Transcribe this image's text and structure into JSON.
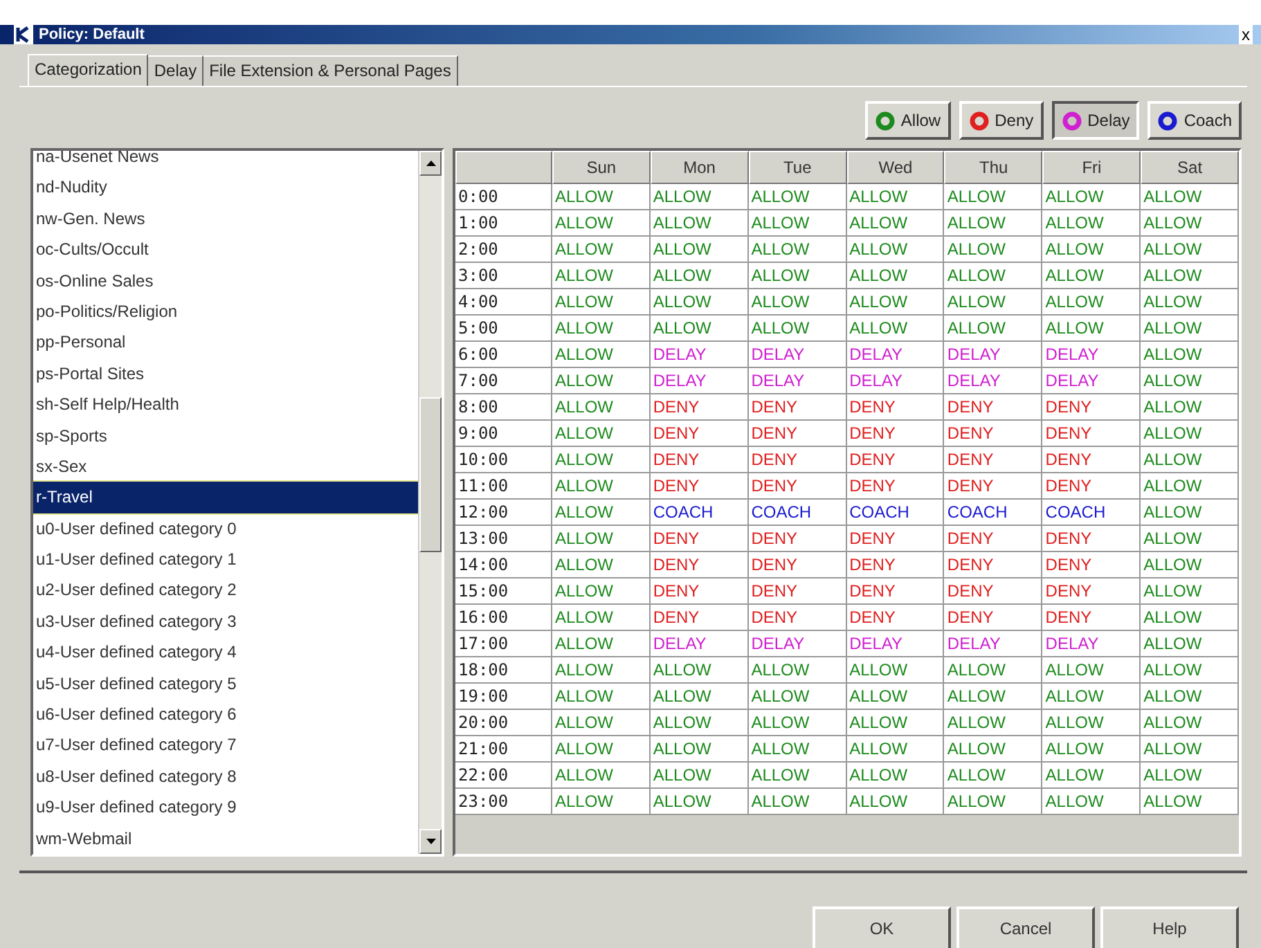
{
  "window": {
    "title": "Policy: Default",
    "close": "x"
  },
  "tabs": [
    {
      "label": "Categorization",
      "selected": true
    },
    {
      "label": "Delay",
      "selected": false
    },
    {
      "label": "File Extension & Personal Pages",
      "selected": false
    }
  ],
  "legend": [
    {
      "label": "Allow",
      "kind": "allow",
      "selected": false
    },
    {
      "label": "Deny",
      "kind": "deny",
      "selected": false
    },
    {
      "label": "Delay",
      "kind": "delay",
      "selected": true
    },
    {
      "label": "Coach",
      "kind": "coach",
      "selected": false
    }
  ],
  "categories": [
    {
      "label": "na-Usenet News",
      "selected": false
    },
    {
      "label": "nd-Nudity",
      "selected": false
    },
    {
      "label": "nw-Gen. News",
      "selected": false
    },
    {
      "label": "oc-Cults/Occult",
      "selected": false
    },
    {
      "label": "os-Online Sales",
      "selected": false
    },
    {
      "label": "po-Politics/Religion",
      "selected": false
    },
    {
      "label": "pp-Personal",
      "selected": false
    },
    {
      "label": "ps-Portal Sites",
      "selected": false
    },
    {
      "label": "sh-Self Help/Health",
      "selected": false
    },
    {
      "label": "sp-Sports",
      "selected": false
    },
    {
      "label": "sx-Sex",
      "selected": false
    },
    {
      "label": "r-Travel",
      "selected": true
    },
    {
      "label": "u0-User defined category 0",
      "selected": false
    },
    {
      "label": "u1-User defined category 1",
      "selected": false
    },
    {
      "label": "u2-User defined category 2",
      "selected": false
    },
    {
      "label": "u3-User defined category 3",
      "selected": false
    },
    {
      "label": "u4-User defined category 4",
      "selected": false
    },
    {
      "label": "u5-User defined category 5",
      "selected": false
    },
    {
      "label": "u6-User defined category 6",
      "selected": false
    },
    {
      "label": "u7-User defined category 7",
      "selected": false
    },
    {
      "label": "u8-User defined category 8",
      "selected": false
    },
    {
      "label": "u9-User defined category 9",
      "selected": false
    },
    {
      "label": "wm-Webmail",
      "selected": false
    }
  ],
  "schedule": {
    "columns": [
      "Sun",
      "Mon",
      "Tue",
      "Wed",
      "Thu",
      "Fri",
      "Sat"
    ],
    "rows": [
      {
        "time": "0:00",
        "cells": [
          {
            "text": "ALLOW",
            "kind": "allow"
          },
          {
            "text": "ALLOW",
            "kind": "allow"
          },
          {
            "text": "ALLOW",
            "kind": "allow"
          },
          {
            "text": "ALLOW",
            "kind": "allow"
          },
          {
            "text": "ALLOW",
            "kind": "allow"
          },
          {
            "text": "ALLOW",
            "kind": "allow"
          },
          {
            "text": "ALLOW",
            "kind": "allow"
          }
        ]
      },
      {
        "time": "1:00",
        "cells": [
          {
            "text": "ALLOW",
            "kind": "allow"
          },
          {
            "text": "ALLOW",
            "kind": "allow"
          },
          {
            "text": "ALLOW",
            "kind": "allow"
          },
          {
            "text": "ALLOW",
            "kind": "allow"
          },
          {
            "text": "ALLOW",
            "kind": "allow"
          },
          {
            "text": "ALLOW",
            "kind": "allow"
          },
          {
            "text": "ALLOW",
            "kind": "allow"
          }
        ]
      },
      {
        "time": "2:00",
        "cells": [
          {
            "text": "ALLOW",
            "kind": "allow"
          },
          {
            "text": "ALLOW",
            "kind": "allow"
          },
          {
            "text": "ALLOW",
            "kind": "allow"
          },
          {
            "text": "ALLOW",
            "kind": "allow"
          },
          {
            "text": "ALLOW",
            "kind": "allow"
          },
          {
            "text": "ALLOW",
            "kind": "allow"
          },
          {
            "text": "ALLOW",
            "kind": "allow"
          }
        ]
      },
      {
        "time": "3:00",
        "cells": [
          {
            "text": "ALLOW",
            "kind": "allow"
          },
          {
            "text": "ALLOW",
            "kind": "allow"
          },
          {
            "text": "ALLOW",
            "kind": "allow"
          },
          {
            "text": "ALLOW",
            "kind": "allow"
          },
          {
            "text": "ALLOW",
            "kind": "allow"
          },
          {
            "text": "ALLOW",
            "kind": "allow"
          },
          {
            "text": "ALLOW",
            "kind": "allow"
          }
        ]
      },
      {
        "time": "4:00",
        "cells": [
          {
            "text": "ALLOW",
            "kind": "allow"
          },
          {
            "text": "ALLOW",
            "kind": "allow"
          },
          {
            "text": "ALLOW",
            "kind": "allow"
          },
          {
            "text": "ALLOW",
            "kind": "allow"
          },
          {
            "text": "ALLOW",
            "kind": "allow"
          },
          {
            "text": "ALLOW",
            "kind": "allow"
          },
          {
            "text": "ALLOW",
            "kind": "allow"
          }
        ]
      },
      {
        "time": "5:00",
        "cells": [
          {
            "text": "ALLOW",
            "kind": "allow"
          },
          {
            "text": "ALLOW",
            "kind": "allow"
          },
          {
            "text": "ALLOW",
            "kind": "allow"
          },
          {
            "text": "ALLOW",
            "kind": "allow"
          },
          {
            "text": "ALLOW",
            "kind": "allow"
          },
          {
            "text": "ALLOW",
            "kind": "allow"
          },
          {
            "text": "ALLOW",
            "kind": "allow"
          }
        ]
      },
      {
        "time": "6:00",
        "cells": [
          {
            "text": "ALLOW",
            "kind": "allow"
          },
          {
            "text": "DELAY",
            "kind": "delay"
          },
          {
            "text": "DELAY",
            "kind": "delay"
          },
          {
            "text": "DELAY",
            "kind": "delay"
          },
          {
            "text": "DELAY",
            "kind": "delay"
          },
          {
            "text": "DELAY",
            "kind": "delay"
          },
          {
            "text": "ALLOW",
            "kind": "allow"
          }
        ]
      },
      {
        "time": "7:00",
        "cells": [
          {
            "text": "ALLOW",
            "kind": "allow"
          },
          {
            "text": "DELAY",
            "kind": "delay"
          },
          {
            "text": "DELAY",
            "kind": "delay"
          },
          {
            "text": "DELAY",
            "kind": "delay"
          },
          {
            "text": "DELAY",
            "kind": "delay"
          },
          {
            "text": "DELAY",
            "kind": "delay"
          },
          {
            "text": "ALLOW",
            "kind": "allow"
          }
        ]
      },
      {
        "time": "8:00",
        "cells": [
          {
            "text": "ALLOW",
            "kind": "allow"
          },
          {
            "text": "DENY",
            "kind": "deny"
          },
          {
            "text": "DENY",
            "kind": "deny"
          },
          {
            "text": "DENY",
            "kind": "deny"
          },
          {
            "text": "DENY",
            "kind": "deny"
          },
          {
            "text": "DENY",
            "kind": "deny"
          },
          {
            "text": "ALLOW",
            "kind": "allow"
          }
        ]
      },
      {
        "time": "9:00",
        "cells": [
          {
            "text": "ALLOW",
            "kind": "allow"
          },
          {
            "text": "DENY",
            "kind": "deny"
          },
          {
            "text": "DENY",
            "kind": "deny"
          },
          {
            "text": "DENY",
            "kind": "deny"
          },
          {
            "text": "DENY",
            "kind": "deny"
          },
          {
            "text": "DENY",
            "kind": "deny"
          },
          {
            "text": "ALLOW",
            "kind": "allow"
          }
        ]
      },
      {
        "time": "10:00",
        "cells": [
          {
            "text": "ALLOW",
            "kind": "allow"
          },
          {
            "text": "DENY",
            "kind": "deny"
          },
          {
            "text": "DENY",
            "kind": "deny"
          },
          {
            "text": "DENY",
            "kind": "deny"
          },
          {
            "text": "DENY",
            "kind": "deny"
          },
          {
            "text": "DENY",
            "kind": "deny"
          },
          {
            "text": "ALLOW",
            "kind": "allow"
          }
        ]
      },
      {
        "time": "11:00",
        "cells": [
          {
            "text": "ALLOW",
            "kind": "allow"
          },
          {
            "text": "DENY",
            "kind": "deny"
          },
          {
            "text": "DENY",
            "kind": "deny"
          },
          {
            "text": "DENY",
            "kind": "deny"
          },
          {
            "text": "DENY",
            "kind": "deny"
          },
          {
            "text": "DENY",
            "kind": "deny"
          },
          {
            "text": "ALLOW",
            "kind": "allow"
          }
        ]
      },
      {
        "time": "12:00",
        "cells": [
          {
            "text": "ALLOW",
            "kind": "allow"
          },
          {
            "text": "COACH",
            "kind": "coach"
          },
          {
            "text": "COACH",
            "kind": "coach"
          },
          {
            "text": "COACH",
            "kind": "coach"
          },
          {
            "text": "COACH",
            "kind": "coach"
          },
          {
            "text": "COACH",
            "kind": "coach"
          },
          {
            "text": "ALLOW",
            "kind": "allow"
          }
        ]
      },
      {
        "time": "13:00",
        "cells": [
          {
            "text": "ALLOW",
            "kind": "allow"
          },
          {
            "text": "DENY",
            "kind": "deny"
          },
          {
            "text": "DENY",
            "kind": "deny"
          },
          {
            "text": "DENY",
            "kind": "deny"
          },
          {
            "text": "DENY",
            "kind": "deny"
          },
          {
            "text": "DENY",
            "kind": "deny"
          },
          {
            "text": "ALLOW",
            "kind": "allow"
          }
        ]
      },
      {
        "time": "14:00",
        "cells": [
          {
            "text": "ALLOW",
            "kind": "allow"
          },
          {
            "text": "DENY",
            "kind": "deny"
          },
          {
            "text": "DENY",
            "kind": "deny"
          },
          {
            "text": "DENY",
            "kind": "deny"
          },
          {
            "text": "DENY",
            "kind": "deny"
          },
          {
            "text": "DENY",
            "kind": "deny"
          },
          {
            "text": "ALLOW",
            "kind": "allow"
          }
        ]
      },
      {
        "time": "15:00",
        "cells": [
          {
            "text": "ALLOW",
            "kind": "allow"
          },
          {
            "text": "DENY",
            "kind": "deny"
          },
          {
            "text": "DENY",
            "kind": "deny"
          },
          {
            "text": "DENY",
            "kind": "deny"
          },
          {
            "text": "DENY",
            "kind": "deny"
          },
          {
            "text": "DENY",
            "kind": "deny"
          },
          {
            "text": "ALLOW",
            "kind": "allow"
          }
        ]
      },
      {
        "time": "16:00",
        "cells": [
          {
            "text": "ALLOW",
            "kind": "allow"
          },
          {
            "text": "DENY",
            "kind": "deny"
          },
          {
            "text": "DENY",
            "kind": "deny"
          },
          {
            "text": "DENY",
            "kind": "deny"
          },
          {
            "text": "DENY",
            "kind": "deny"
          },
          {
            "text": "DENY",
            "kind": "deny"
          },
          {
            "text": "ALLOW",
            "kind": "allow"
          }
        ]
      },
      {
        "time": "17:00",
        "cells": [
          {
            "text": "ALLOW",
            "kind": "allow"
          },
          {
            "text": "DELAY",
            "kind": "delay"
          },
          {
            "text": "DELAY",
            "kind": "delay"
          },
          {
            "text": "DELAY",
            "kind": "delay"
          },
          {
            "text": "DELAY",
            "kind": "delay"
          },
          {
            "text": "DELAY",
            "kind": "delay"
          },
          {
            "text": "ALLOW",
            "kind": "allow"
          }
        ]
      },
      {
        "time": "18:00",
        "cells": [
          {
            "text": "ALLOW",
            "kind": "allow"
          },
          {
            "text": "ALLOW",
            "kind": "allow"
          },
          {
            "text": "ALLOW",
            "kind": "allow"
          },
          {
            "text": "ALLOW",
            "kind": "allow"
          },
          {
            "text": "ALLOW",
            "kind": "allow"
          },
          {
            "text": "ALLOW",
            "kind": "allow"
          },
          {
            "text": "ALLOW",
            "kind": "allow"
          }
        ]
      },
      {
        "time": "19:00",
        "cells": [
          {
            "text": "ALLOW",
            "kind": "allow"
          },
          {
            "text": "ALLOW",
            "kind": "allow"
          },
          {
            "text": "ALLOW",
            "kind": "allow"
          },
          {
            "text": "ALLOW",
            "kind": "allow"
          },
          {
            "text": "ALLOW",
            "kind": "allow"
          },
          {
            "text": "ALLOW",
            "kind": "allow"
          },
          {
            "text": "ALLOW",
            "kind": "allow"
          }
        ]
      },
      {
        "time": "20:00",
        "cells": [
          {
            "text": "ALLOW",
            "kind": "allow"
          },
          {
            "text": "ALLOW",
            "kind": "allow"
          },
          {
            "text": "ALLOW",
            "kind": "allow"
          },
          {
            "text": "ALLOW",
            "kind": "allow"
          },
          {
            "text": "ALLOW",
            "kind": "allow"
          },
          {
            "text": "ALLOW",
            "kind": "allow"
          },
          {
            "text": "ALLOW",
            "kind": "allow"
          }
        ]
      },
      {
        "time": "21:00",
        "cells": [
          {
            "text": "ALLOW",
            "kind": "allow"
          },
          {
            "text": "ALLOW",
            "kind": "allow"
          },
          {
            "text": "ALLOW",
            "kind": "allow"
          },
          {
            "text": "ALLOW",
            "kind": "allow"
          },
          {
            "text": "ALLOW",
            "kind": "allow"
          },
          {
            "text": "ALLOW",
            "kind": "allow"
          },
          {
            "text": "ALLOW",
            "kind": "allow"
          }
        ]
      },
      {
        "time": "22:00",
        "cells": [
          {
            "text": "ALLOW",
            "kind": "allow"
          },
          {
            "text": "ALLOW",
            "kind": "allow"
          },
          {
            "text": "ALLOW",
            "kind": "allow"
          },
          {
            "text": "ALLOW",
            "kind": "allow"
          },
          {
            "text": "ALLOW",
            "kind": "allow"
          },
          {
            "text": "ALLOW",
            "kind": "allow"
          },
          {
            "text": "ALLOW",
            "kind": "allow"
          }
        ]
      },
      {
        "time": "23:00",
        "cells": [
          {
            "text": "ALLOW",
            "kind": "allow"
          },
          {
            "text": "ALLOW",
            "kind": "allow"
          },
          {
            "text": "ALLOW",
            "kind": "allow"
          },
          {
            "text": "ALLOW",
            "kind": "allow"
          },
          {
            "text": "ALLOW",
            "kind": "allow"
          },
          {
            "text": "ALLOW",
            "kind": "allow"
          },
          {
            "text": "ALLOW",
            "kind": "allow"
          }
        ]
      }
    ]
  },
  "buttons": [
    "OK",
    "Cancel",
    "Help"
  ]
}
